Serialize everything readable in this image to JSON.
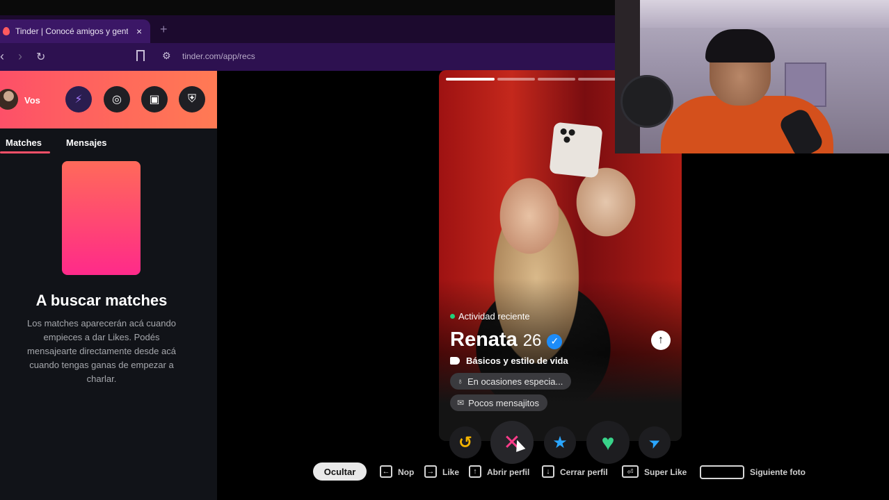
{
  "browser": {
    "tab_title": "Tinder | Conocé amigos y gente",
    "tab_close": "×",
    "new_tab": "+",
    "url": "tinder.com/app/recs",
    "back": "‹",
    "forward": "›",
    "reload": "↻"
  },
  "sidebar": {
    "user_label": "Vos",
    "header_buttons": [
      {
        "icon": "bolt-icon",
        "glyph": "⚡"
      },
      {
        "icon": "compass-icon",
        "glyph": "◎"
      },
      {
        "icon": "briefcase-icon",
        "glyph": "▣"
      },
      {
        "icon": "shield-icon",
        "glyph": "⛨"
      }
    ],
    "tabs": [
      {
        "label": "Matches"
      },
      {
        "label": "Mensajes"
      }
    ],
    "empty_state": {
      "title": "A buscar matches",
      "description": "Los matches aparecerán acá cuando empieces a dar Likes. Podés mensajearte directamente desde acá cuando tengas ganas de empezar a charlar."
    }
  },
  "profile": {
    "activity": "Actividad reciente",
    "name": "Renata",
    "age": "26",
    "verified_glyph": "✓",
    "expand_glyph": "↑",
    "basics_title": "Básicos y estilo de vida",
    "chips": [
      {
        "icon": "drink-icon",
        "glyph": "🍷",
        "label": "En ocasiones especia..."
      },
      {
        "icon": "message-icon",
        "glyph": "✉",
        "label": "Pocos mensajitos"
      }
    ],
    "photo_count": 4,
    "current_photo": 1
  },
  "actions": {
    "rewind": {
      "glyph": "↺",
      "color": "#f5b400"
    },
    "nope": {
      "glyph": "✕",
      "color": "#ff3c8a"
    },
    "superlike": {
      "glyph": "★",
      "color": "#2aa6ff"
    },
    "like": {
      "glyph": "♥",
      "color": "#39d38a"
    },
    "boost": {
      "glyph": "➤",
      "color": "#2aa6ff"
    }
  },
  "shortcuts": {
    "hide_label": "Ocultar",
    "items": [
      {
        "key": "←",
        "label": "Nop"
      },
      {
        "key": "→",
        "label": "Like"
      },
      {
        "key": "↑",
        "label": "Abrir perfil"
      },
      {
        "key": "↓",
        "label": "Cerrar perfil"
      },
      {
        "key": "⏎",
        "label": "Super Like"
      },
      {
        "key": "",
        "label": "Siguiente foto"
      }
    ]
  },
  "colors": {
    "brand_gradient_start": "#fd5068",
    "brand_gradient_end": "#ff7a54",
    "sidebar_bg": "#111318",
    "verified_blue": "#1d8cf8"
  }
}
